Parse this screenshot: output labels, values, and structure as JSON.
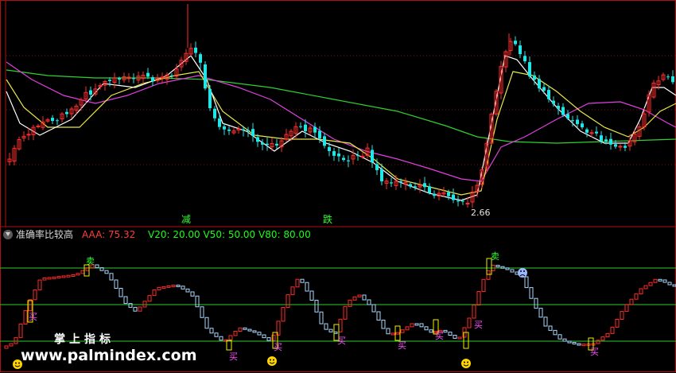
{
  "indicator": {
    "name": "准确率比较高",
    "aaa_text": "AAA: 75.32",
    "levels_text": "V20: 20.00  V50: 50.00  V80: 80.00"
  },
  "main_chart": {
    "low_label": "2.66",
    "signal_jian": "减",
    "signal_die": "跌"
  },
  "signals": {
    "buy": "买",
    "sell": "卖"
  },
  "watermark": {
    "line1": "掌上指标",
    "line2": "www.palmindex.com"
  },
  "colors": {
    "background": "#000000",
    "candle_up": "#ff2d2d",
    "candle_down": "#22e6e6",
    "ma_fast": "#ffffff",
    "ma_mid": "#e8e84a",
    "ma_slow": "#e040e0",
    "ma_long": "#30d030",
    "indicator_up": "#ff2a2a",
    "indicator_down": "#a8d8ff",
    "level_lines": "#2ecc2e",
    "signal_box": "#f0f000",
    "panel_border": "#b01010"
  },
  "icons": {
    "settings": "gear-icon",
    "smiley": "smiley-icon",
    "sad": "sad-face-icon"
  }
}
